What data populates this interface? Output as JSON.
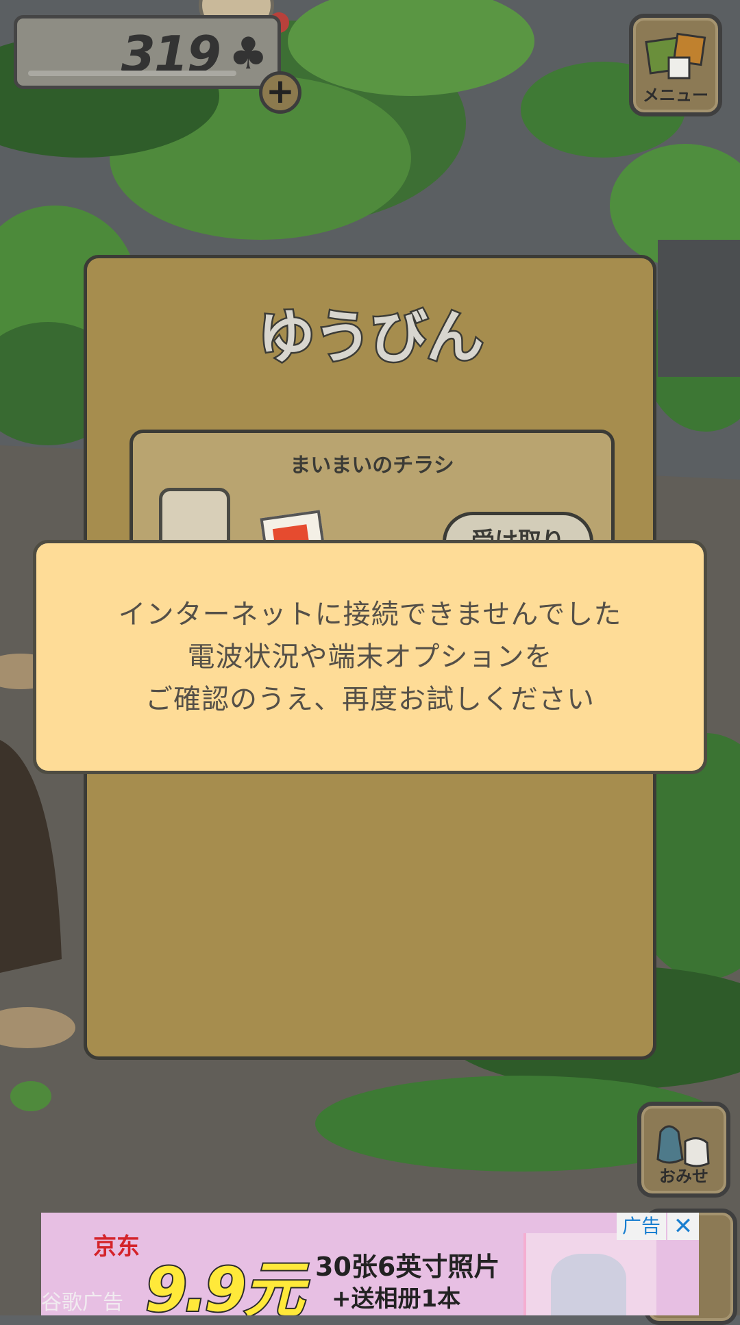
{
  "hud": {
    "clover_count": "319",
    "clover_symbol": "♣",
    "add_symbol": "+",
    "menu_label": "メニュー",
    "shop_label": "おみせ"
  },
  "mail": {
    "title": "ゆうびん",
    "item_title": "まいまいのチラシ",
    "receive_button": "受け取り"
  },
  "error": {
    "lines": [
      "インターネットに接続できませんでした",
      "電波状況や端末オプションを",
      "ご確認のうえ、再度お試しください"
    ]
  },
  "ad": {
    "brand": "京东",
    "price": "9.9元",
    "line1": "30张6英寸照片",
    "line2": "+送相册1本",
    "label": "广告",
    "close_symbol": "✕",
    "network": "谷歌广告"
  },
  "colors": {
    "panel": "#a68d4e",
    "dialog": "#fedc97",
    "ad_background": "#e7bfe3"
  }
}
